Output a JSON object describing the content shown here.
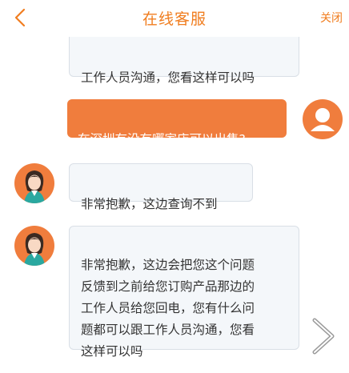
{
  "header": {
    "title": "在线客服",
    "close_label": "关闭",
    "accent_color": "#f07d1f",
    "back_icon": "chevron-left-icon"
  },
  "messages": [
    {
      "sender": "agent",
      "text": "工作人员沟通，您看这样可以吗",
      "avatar_icon": "agent-avatar"
    },
    {
      "sender": "user",
      "text": "在深圳有没有哪家店可以出售?",
      "avatar_icon": "user-avatar"
    },
    {
      "sender": "agent",
      "text": "非常抱歉，这边查询不到",
      "avatar_icon": "agent-avatar"
    },
    {
      "sender": "agent",
      "text": "非常抱歉，这边会把您这个问题\n反馈到之前给您订购产品那边的\n工作人员给您回电，您有什么问\n题都可以跟工作人员沟通，您看\n这样可以吗",
      "avatar_icon": "agent-avatar"
    }
  ],
  "next_icon": "chevron-right-icon"
}
